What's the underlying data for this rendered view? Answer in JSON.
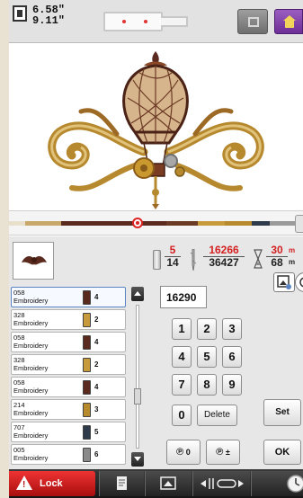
{
  "header": {
    "size_width": "6.58\"",
    "size_height": "9.11\"",
    "home_color": "#7b3aa8"
  },
  "design": {
    "description_icon": "hot-air-balloon-embroidery"
  },
  "stitch_counter": {
    "color_index": "5",
    "color_total": "14",
    "stitches_done": "16266",
    "stitches_total": "36427",
    "time_done": "30",
    "time_total": "68",
    "time_unit": "m"
  },
  "thread_list": [
    {
      "code": "058",
      "type": "Embroidery",
      "color": "#5a2a1e",
      "index": "4"
    },
    {
      "code": "328",
      "type": "Embroidery",
      "color": "#c79b3c",
      "index": "2"
    },
    {
      "code": "058",
      "type": "Embroidery",
      "color": "#5a2a1e",
      "index": "4"
    },
    {
      "code": "328",
      "type": "Embroidery",
      "color": "#c79b3c",
      "index": "2"
    },
    {
      "code": "058",
      "type": "Embroidery",
      "color": "#5a2a1e",
      "index": "4"
    },
    {
      "code": "214",
      "type": "Embroidery",
      "color": "#b88a2e",
      "index": "3"
    },
    {
      "code": "707",
      "type": "Embroidery",
      "color": "#2e3a4a",
      "index": "5"
    },
    {
      "code": "005",
      "type": "Embroidery",
      "color": "#8a8a8a",
      "index": "6"
    }
  ],
  "keypad": {
    "entry_value": "16290",
    "keys": [
      "1",
      "2",
      "3",
      "4",
      "5",
      "6",
      "7",
      "8",
      "9",
      "0"
    ],
    "delete_label": "Delete",
    "set_label": "Set",
    "ok_label": "OK",
    "needle_minus_label": "0",
    "needle_plusminus_label": "±"
  },
  "bottom_bar": {
    "lock_label": "Lock",
    "accent": "#d62020"
  }
}
